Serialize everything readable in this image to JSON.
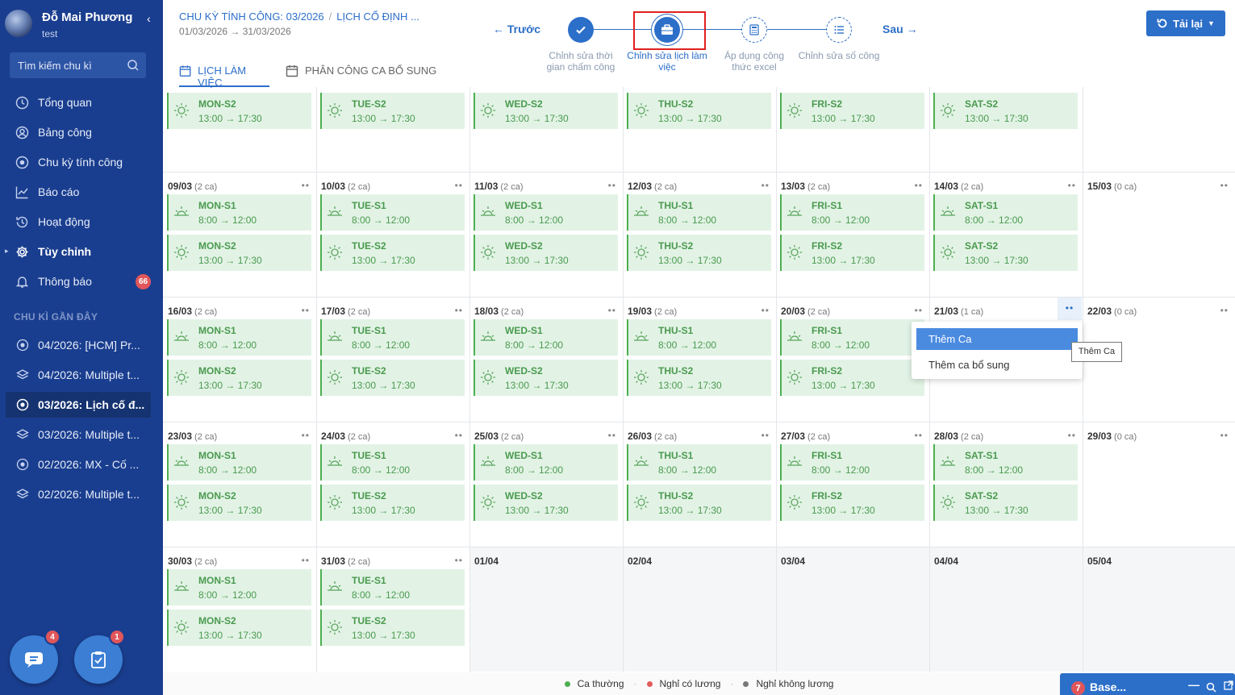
{
  "user": {
    "name": "Đỗ Mai Phương",
    "subtitle": "test"
  },
  "search": {
    "placeholder": "Tìm kiếm chu kì"
  },
  "nav": [
    {
      "label": "Tổng quan",
      "icon": "clock-icon"
    },
    {
      "label": "Bảng công",
      "icon": "user-circle-icon"
    },
    {
      "label": "Chu kỳ tính công",
      "icon": "target-icon"
    },
    {
      "label": "Báo cáo",
      "icon": "chart-icon"
    },
    {
      "label": "Hoạt động",
      "icon": "history-icon"
    },
    {
      "label": "Tùy chỉnh",
      "icon": "gear-icon"
    },
    {
      "label": "Thông báo",
      "icon": "bell-icon"
    }
  ],
  "notification_count": "66",
  "recent_title": "CHU KÌ GẦN ĐÂY",
  "recent": [
    {
      "label": "04/2026: [HCM] Pr...",
      "icon": "target-icon"
    },
    {
      "label": "04/2026: Multiple t...",
      "icon": "layers-icon"
    },
    {
      "label": "03/2026: Lịch cố đ...",
      "icon": "target-icon"
    },
    {
      "label": "03/2026: Multiple t...",
      "icon": "layers-icon"
    },
    {
      "label": "02/2026: MX - Cố ...",
      "icon": "target-icon"
    },
    {
      "label": "02/2026: Multiple t...",
      "icon": "layers-icon"
    }
  ],
  "fab": {
    "chat_badge": "4",
    "task_badge": "1"
  },
  "header": {
    "breadcrumb1": "CHU KỲ TÍNH CÔNG: 03/2026",
    "breadcrumb2": "LỊCH CỐ ĐỊNH ...",
    "date_range": "01/03/2026 → 31/03/2026",
    "prev": "← Trước",
    "next": "Sau →",
    "reload": "Tải lại"
  },
  "tabs": [
    "LỊCH LÀM VIỆC",
    "PHÂN CÔNG CA BỔ SUNG"
  ],
  "steps": [
    {
      "line1": "Chỉnh sửa thời",
      "line2": "gian chấm công"
    },
    {
      "line1": "Chỉnh sửa lịch làm",
      "line2": "việc"
    },
    {
      "line1": "Áp dụng công",
      "line2": "thức excel"
    },
    {
      "line1": "Chỉnh sửa số công",
      "line2": ""
    }
  ],
  "calendar": {
    "top_row": [
      {
        "shifts": [
          {
            "name": "",
            "time": "8:00 → 12:00"
          },
          {
            "name": "MON-S2",
            "time": "13:00 → 17:30"
          }
        ]
      },
      {
        "shifts": [
          {
            "name": "",
            "time": "8:00 → 12:00"
          },
          {
            "name": "TUE-S2",
            "time": "13:00 → 17:30"
          }
        ]
      },
      {
        "shifts": [
          {
            "name": "",
            "time": "8:00 → 12:00",
            "red": true
          },
          {
            "name": "WED-S2",
            "time": "13:00 → 17:30"
          }
        ]
      },
      {
        "shifts": [
          {
            "name": "",
            "time": "8:00 → 12:00"
          },
          {
            "name": "THU-S2",
            "time": "13:00 → 17:30"
          }
        ]
      },
      {
        "shifts": [
          {
            "name": "",
            "time": "8:00 → 12:00"
          },
          {
            "name": "FRI-S2",
            "time": "13:00 → 17:30"
          }
        ]
      },
      {
        "shifts": [
          {
            "name": "",
            "time": "8:00 → 12:00"
          },
          {
            "name": "SAT-S2",
            "time": "13:00 → 17:30"
          }
        ]
      },
      {
        "shifts": []
      }
    ],
    "weeks": [
      [
        {
          "date": "09/03",
          "count": "(2 ca)",
          "shifts": [
            {
              "name": "MON-S1",
              "time": "8:00 → 12:00"
            },
            {
              "name": "MON-S2",
              "time": "13:00 → 17:30"
            }
          ]
        },
        {
          "date": "10/03",
          "count": "(2 ca)",
          "shifts": [
            {
              "name": "TUE-S1",
              "time": "8:00 → 12:00"
            },
            {
              "name": "TUE-S2",
              "time": "13:00 → 17:30"
            }
          ]
        },
        {
          "date": "11/03",
          "count": "(2 ca)",
          "shifts": [
            {
              "name": "WED-S1",
              "time": "8:00 → 12:00"
            },
            {
              "name": "WED-S2",
              "time": "13:00 → 17:30"
            }
          ]
        },
        {
          "date": "12/03",
          "count": "(2 ca)",
          "shifts": [
            {
              "name": "THU-S1",
              "time": "8:00 → 12:00"
            },
            {
              "name": "THU-S2",
              "time": "13:00 → 17:30"
            }
          ]
        },
        {
          "date": "13/03",
          "count": "(2 ca)",
          "shifts": [
            {
              "name": "FRI-S1",
              "time": "8:00 → 12:00"
            },
            {
              "name": "FRI-S2",
              "time": "13:00 → 17:30"
            }
          ]
        },
        {
          "date": "14/03",
          "count": "(2 ca)",
          "shifts": [
            {
              "name": "SAT-S1",
              "time": "8:00 → 12:00"
            },
            {
              "name": "SAT-S2",
              "time": "13:00 → 17:30"
            }
          ]
        },
        {
          "date": "15/03",
          "count": "(0 ca)",
          "shifts": []
        }
      ],
      [
        {
          "date": "16/03",
          "count": "(2 ca)",
          "shifts": [
            {
              "name": "MON-S1",
              "time": "8:00 → 12:00"
            },
            {
              "name": "MON-S2",
              "time": "13:00 → 17:30"
            }
          ]
        },
        {
          "date": "17/03",
          "count": "(2 ca)",
          "shifts": [
            {
              "name": "TUE-S1",
              "time": "8:00 → 12:00"
            },
            {
              "name": "TUE-S2",
              "time": "13:00 → 17:30"
            }
          ]
        },
        {
          "date": "18/03",
          "count": "(2 ca)",
          "shifts": [
            {
              "name": "WED-S1",
              "time": "8:00 → 12:00"
            },
            {
              "name": "WED-S2",
              "time": "13:00 → 17:30"
            }
          ]
        },
        {
          "date": "19/03",
          "count": "(2 ca)",
          "shifts": [
            {
              "name": "THU-S1",
              "time": "8:00 → 12:00"
            },
            {
              "name": "THU-S2",
              "time": "13:00 → 17:30"
            }
          ]
        },
        {
          "date": "20/03",
          "count": "(2 ca)",
          "shifts": [
            {
              "name": "FRI-S1",
              "time": "8:00 → 12:00"
            },
            {
              "name": "FRI-S2",
              "time": "13:00 → 17:30"
            }
          ]
        },
        {
          "date": "21/03",
          "count": "(1 ca)",
          "shifts": [],
          "menu_open": true
        },
        {
          "date": "22/03",
          "count": "(0 ca)",
          "shifts": []
        }
      ],
      [
        {
          "date": "23/03",
          "count": "(2 ca)",
          "shifts": [
            {
              "name": "MON-S1",
              "time": "8:00 → 12:00"
            },
            {
              "name": "MON-S2",
              "time": "13:00 → 17:30"
            }
          ]
        },
        {
          "date": "24/03",
          "count": "(2 ca)",
          "shifts": [
            {
              "name": "TUE-S1",
              "time": "8:00 → 12:00"
            },
            {
              "name": "TUE-S2",
              "time": "13:00 → 17:30"
            }
          ]
        },
        {
          "date": "25/03",
          "count": "(2 ca)",
          "shifts": [
            {
              "name": "WED-S1",
              "time": "8:00 → 12:00"
            },
            {
              "name": "WED-S2",
              "time": "13:00 → 17:30"
            }
          ]
        },
        {
          "date": "26/03",
          "count": "(2 ca)",
          "shifts": [
            {
              "name": "THU-S1",
              "time": "8:00 → 12:00"
            },
            {
              "name": "THU-S2",
              "time": "13:00 → 17:30"
            }
          ]
        },
        {
          "date": "27/03",
          "count": "(2 ca)",
          "shifts": [
            {
              "name": "FRI-S1",
              "time": "8:00 → 12:00"
            },
            {
              "name": "FRI-S2",
              "time": "13:00 → 17:30"
            }
          ]
        },
        {
          "date": "28/03",
          "count": "(2 ca)",
          "shifts": [
            {
              "name": "SAT-S1",
              "time": "8:00 → 12:00"
            },
            {
              "name": "SAT-S2",
              "time": "13:00 → 17:30"
            }
          ]
        },
        {
          "date": "29/03",
          "count": "(0 ca)",
          "shifts": []
        }
      ],
      [
        {
          "date": "30/03",
          "count": "(2 ca)",
          "shifts": [
            {
              "name": "MON-S1",
              "time": "8:00 → 12:00"
            },
            {
              "name": "MON-S2",
              "time": "13:00 → 17:30"
            }
          ]
        },
        {
          "date": "31/03",
          "count": "(2 ca)",
          "shifts": [
            {
              "name": "TUE-S1",
              "time": "8:00 → 12:00"
            },
            {
              "name": "TUE-S2",
              "time": "13:00 → 17:30"
            }
          ]
        },
        {
          "date": "01/04",
          "count": "",
          "shifts": [],
          "out": true
        },
        {
          "date": "02/04",
          "count": "",
          "shifts": [],
          "out": true
        },
        {
          "date": "03/04",
          "count": "",
          "shifts": [],
          "out": true
        },
        {
          "date": "04/04",
          "count": "",
          "shifts": [],
          "out": true
        },
        {
          "date": "05/04",
          "count": "",
          "shifts": [],
          "out": true
        }
      ]
    ]
  },
  "context_menu": {
    "items": [
      "Thêm Ca",
      "Thêm ca bổ sung"
    ],
    "tooltip": "Thêm Ca"
  },
  "legend": [
    {
      "label": "Ca thường",
      "color": "#4caf50"
    },
    {
      "label": "Nghỉ có lương",
      "color": "#e25b5b"
    },
    {
      "label": "Nghỉ không lương",
      "color": "#777777"
    }
  ],
  "base_window": {
    "badge": "7",
    "title": "Base..."
  }
}
